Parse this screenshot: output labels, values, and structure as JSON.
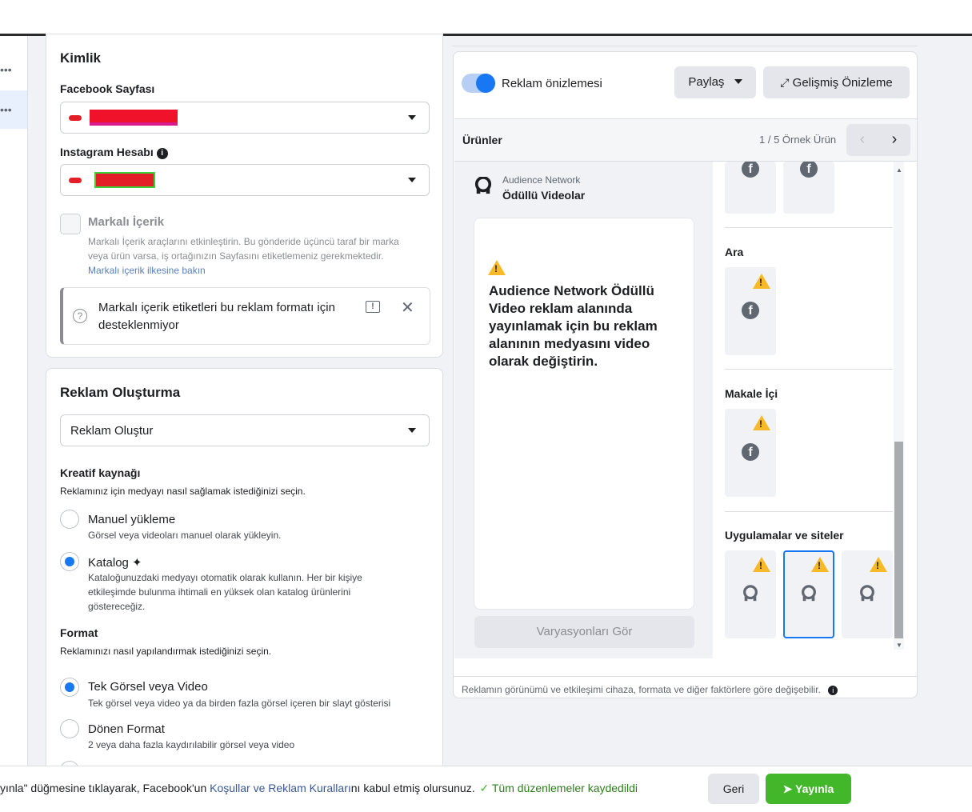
{
  "identity": {
    "title": "Kimlik",
    "fb_page_label": "Facebook Sayfası",
    "ig_label": "Instagram Hesabı",
    "branded_label": "Markalı İçerik",
    "branded_desc": "Markalı İçerik araçlarını etkinleştirin. Bu gönderide üçüncü taraf bir marka veya ürün varsa, iş ortağınızın Sayfasını etiketlemeniz gerekmektedir.",
    "branded_link": "Markalı içerik ilkesine bakın",
    "notice": "Markalı içerik etiketleri bu reklam formatı için desteklenmiyor"
  },
  "creation": {
    "title": "Reklam Oluşturma",
    "select_value": "Reklam Oluştur",
    "source_label": "Kreatif kaynağı",
    "source_desc": "Reklamınız için medyayı nasıl sağlamak istediğinizi seçin.",
    "manual_label": "Manuel yükleme",
    "manual_desc": "Görsel veya videoları manuel olarak yükleyin.",
    "catalog_label": "Katalog",
    "catalog_desc": "Kataloğunuzdaki medyayı otomatik olarak kullanın. Her bir kişiye etkileşimde bulunma ihtimali en yüksek olan katalog ürünlerini göstereceğiz.",
    "format_label": "Format",
    "format_desc": "Reklamınızı nasıl yapılandırmak istediğinizi seçin.",
    "single_label": "Tek Görsel veya Video",
    "single_desc": "Tek görsel veya video ya da birden fazla görsel içeren bir slayt gösterisi",
    "carousel_label": "Dönen Format",
    "carousel_desc": "2 veya daha fazla kaydırılabilir görsel veya video"
  },
  "preview": {
    "toggle_label": "Reklam önizlemesi",
    "share_label": "Paylaş",
    "advanced_label": "Gelişmiş Önizleme",
    "products_label": "Ürünler",
    "counter": "1 / 5 Örnek Ürün",
    "network_label": "Audience Network",
    "placement_name": "Ödüllü Videolar",
    "warning_text": "Audience Network Ödüllü Video reklam alanında yayınlamak için bu reklam alanının medyasını video olarak değiştirin.",
    "variations_button": "Varyasyonları Gör",
    "section_search": "Ara",
    "section_article": "Makale İçi",
    "section_apps": "Uygulamalar ve siteler",
    "disclaimer": "Reklamın görünümü ve etkileşimi cihaza, formata ve diğer faktörlere göre değişebilir."
  },
  "footer": {
    "terms_prefix": "yınla\" düğmesine tıklayarak, Facebook'un",
    "terms_link": "Koşullar ve Reklam Kuralları",
    "terms_suffix": "nı kabul etmiş olursunuz.",
    "saved": "Tüm düzenlemeler kaydedildi",
    "back_label": "Geri",
    "publish_label": "Yayınla"
  },
  "colors": {
    "accent": "#1877f2",
    "success": "#42b72a",
    "warning": "#f7b928",
    "link": "#385898"
  }
}
